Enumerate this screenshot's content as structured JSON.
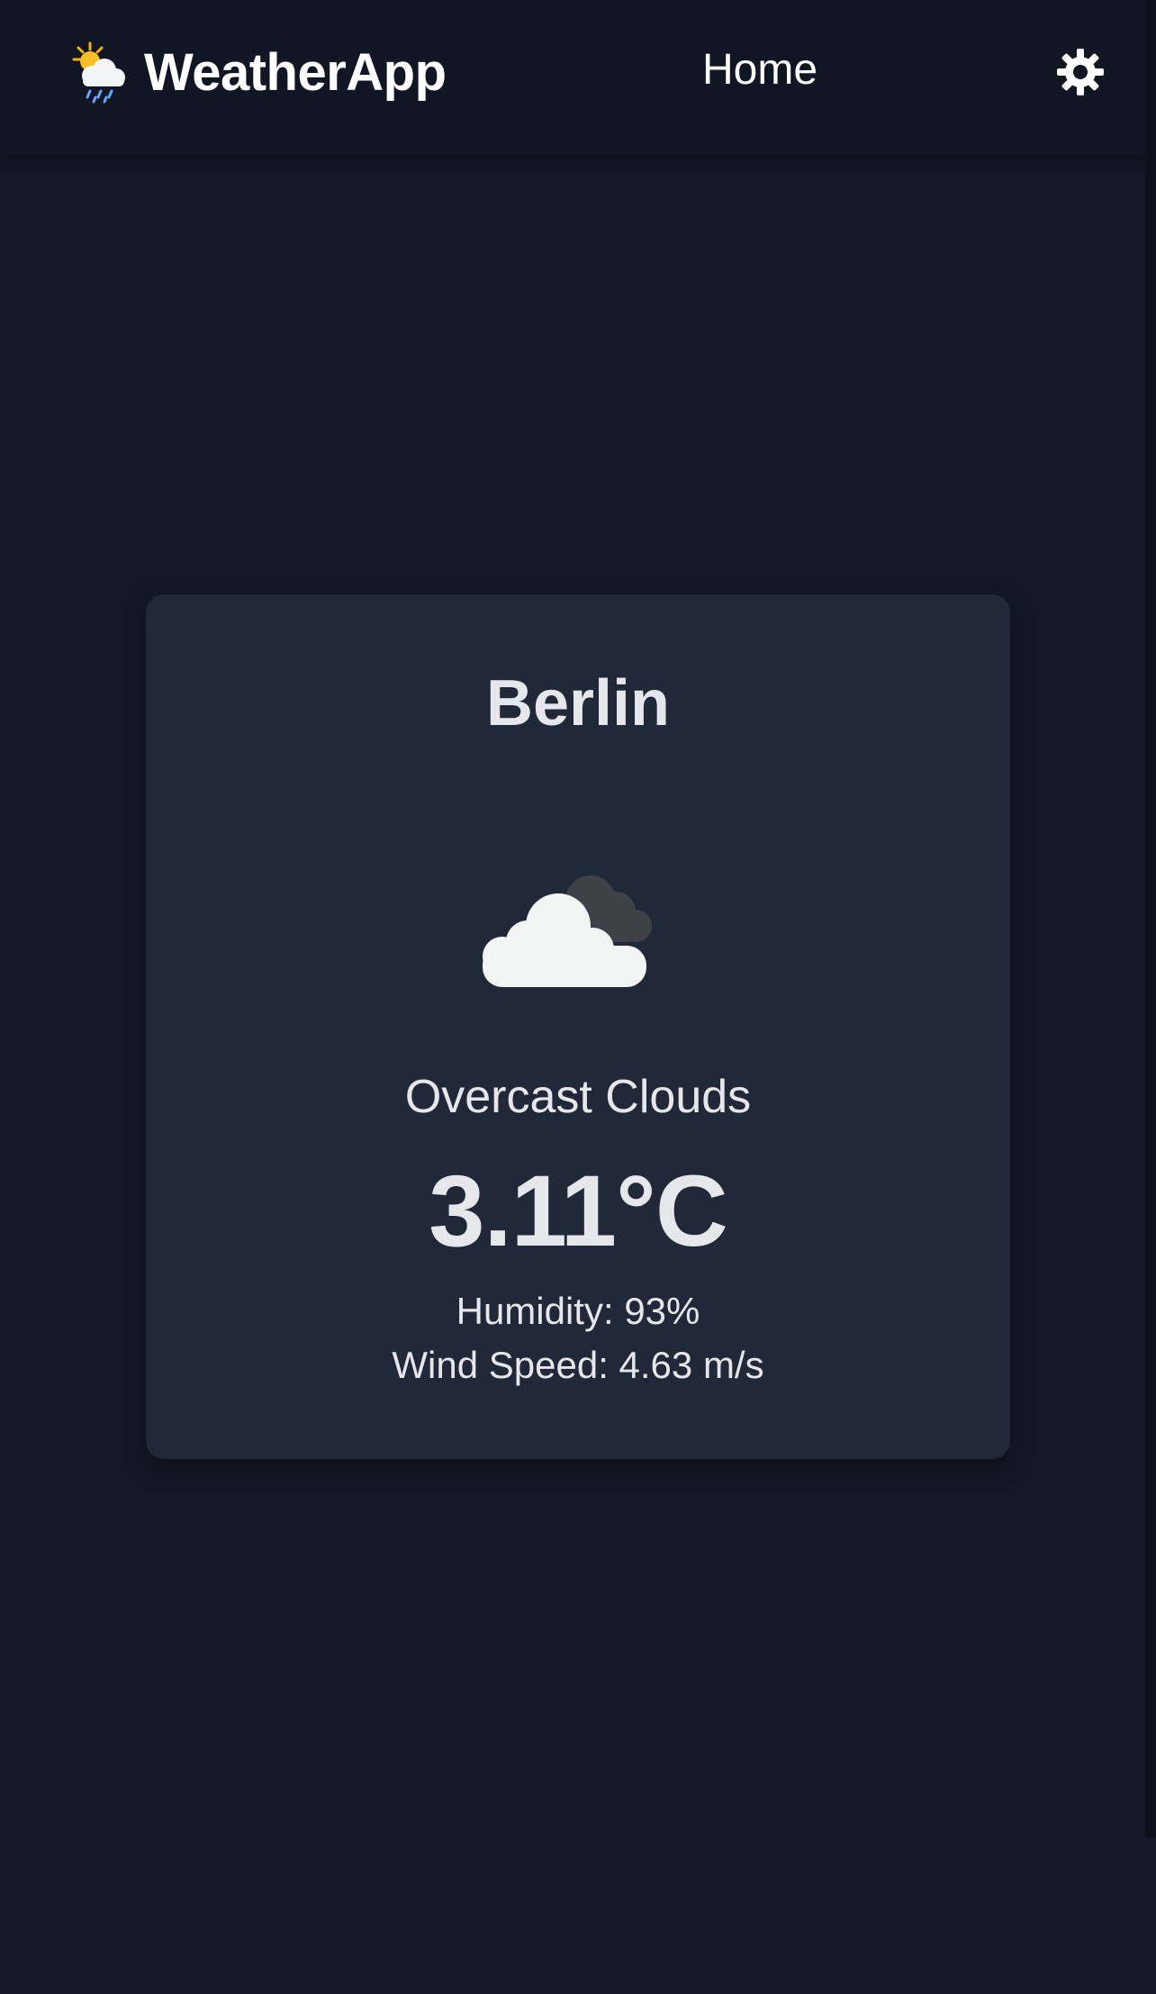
{
  "app": {
    "name": "WeatherApp",
    "logo_icon": "sun-behind-rain-cloud-icon"
  },
  "nav": {
    "home_label": "Home",
    "settings_icon": "gear-icon"
  },
  "weather": {
    "city": "Berlin",
    "icon": "overcast-clouds-icon",
    "description": "Overcast Clouds",
    "temperature": "3.11°C",
    "humidity": "Humidity: 93%",
    "wind_speed": "Wind Speed: 4.63 m/s"
  },
  "colors": {
    "background": "#121826",
    "navbar": "#101623",
    "card": "#212938",
    "text": "#e5e7eb"
  }
}
